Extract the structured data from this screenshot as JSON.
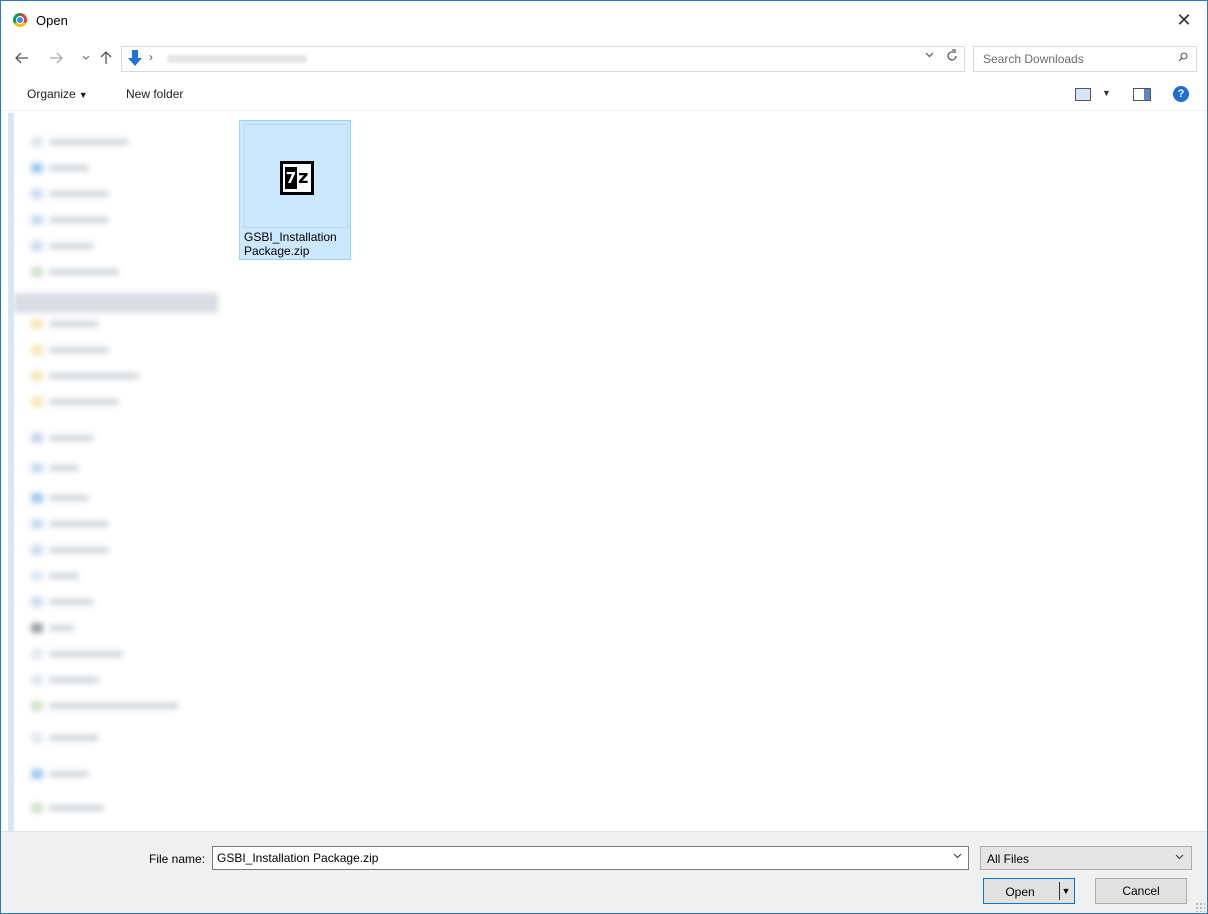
{
  "window": {
    "title": "Open",
    "close_label": "✕"
  },
  "nav": {
    "back_icon": "arrow-left-icon",
    "forward_icon": "arrow-right-icon",
    "up_icon": "arrow-up-icon",
    "address_separator": "›",
    "search_placeholder": "Search Downloads"
  },
  "toolbar": {
    "organize_label": "Organize",
    "new_folder_label": "New folder",
    "help_label": "?"
  },
  "files": [
    {
      "name": "GSBI_Installation Package.zip",
      "display_name": "GSBI_Installation Package.zip",
      "selected": true,
      "icon": "7zip-archive-icon"
    }
  ],
  "bottom": {
    "file_name_label": "File name:",
    "file_name_value": "GSBI_Installation Package.zip",
    "file_type_value": "All Files",
    "open_label": "Open",
    "cancel_label": "Cancel"
  },
  "colors": {
    "selection_bg": "#cce8ff",
    "selection_border": "#99d1ff",
    "accent": "#0078d7",
    "window_border": "#2b79c2"
  }
}
